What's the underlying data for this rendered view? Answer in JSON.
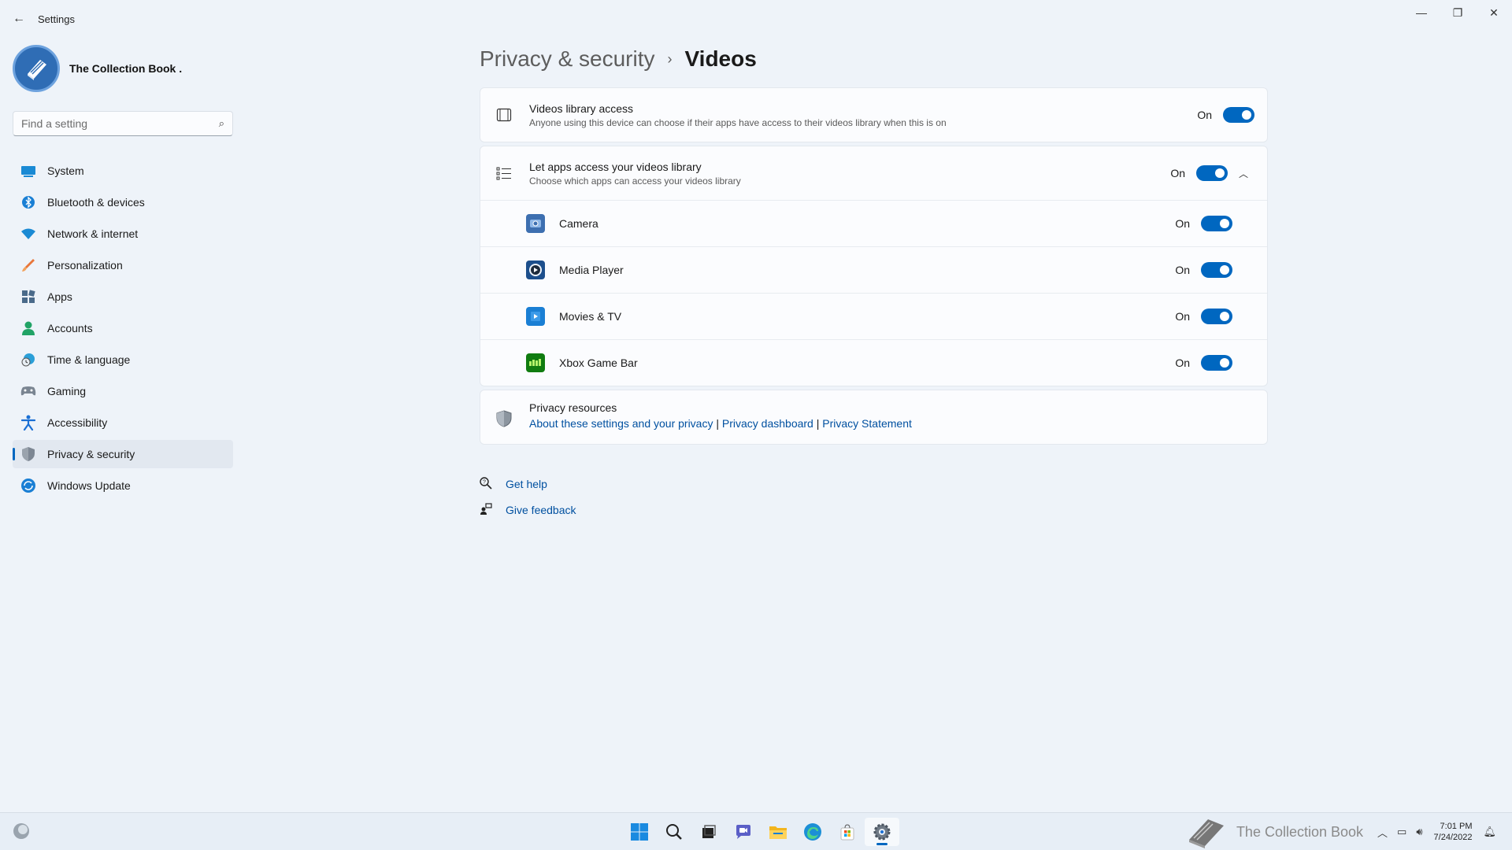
{
  "window": {
    "title": "Settings",
    "back_icon": "back-arrow-icon",
    "controls": [
      "minimize-icon",
      "restore-icon",
      "close-icon"
    ]
  },
  "profile": {
    "name": "The Collection Book ."
  },
  "search": {
    "placeholder": "Find a setting"
  },
  "nav": [
    {
      "label": "System",
      "icon": "system-icon"
    },
    {
      "label": "Bluetooth & devices",
      "icon": "bluetooth-icon"
    },
    {
      "label": "Network & internet",
      "icon": "wifi-icon"
    },
    {
      "label": "Personalization",
      "icon": "brush-icon"
    },
    {
      "label": "Apps",
      "icon": "apps-icon"
    },
    {
      "label": "Accounts",
      "icon": "accounts-icon"
    },
    {
      "label": "Time & language",
      "icon": "clock-globe-icon"
    },
    {
      "label": "Gaming",
      "icon": "controller-icon"
    },
    {
      "label": "Accessibility",
      "icon": "accessibility-icon"
    },
    {
      "label": "Privacy & security",
      "icon": "shield-icon",
      "active": true
    },
    {
      "label": "Windows Update",
      "icon": "update-icon"
    }
  ],
  "breadcrumb": {
    "parent": "Privacy & security",
    "separator": "›",
    "current": "Videos"
  },
  "library_access": {
    "title": "Videos library access",
    "subtitle": "Anyone using this device can choose if their apps have access to their videos library when this is on",
    "state": "On"
  },
  "apps_access": {
    "title": "Let apps access your videos library",
    "subtitle": "Choose which apps can access your videos library",
    "state": "On",
    "apps": [
      {
        "name": "Camera",
        "state": "On"
      },
      {
        "name": "Media Player",
        "state": "On"
      },
      {
        "name": "Movies & TV",
        "state": "On"
      },
      {
        "name": "Xbox Game Bar",
        "state": "On"
      }
    ]
  },
  "resources": {
    "title": "Privacy resources",
    "link1": "About these settings and your privacy",
    "link2": "Privacy dashboard",
    "link3": "Privacy Statement",
    "sep": "|"
  },
  "help": {
    "get_help": "Get help",
    "feedback": "Give feedback"
  },
  "taskbar": {
    "watermark": "The Collection Book",
    "time": "7:01 PM",
    "date": "7/24/2022"
  },
  "colors": {
    "accent": "#0067c0",
    "link": "#0050a0",
    "background": "#eef3f9"
  }
}
